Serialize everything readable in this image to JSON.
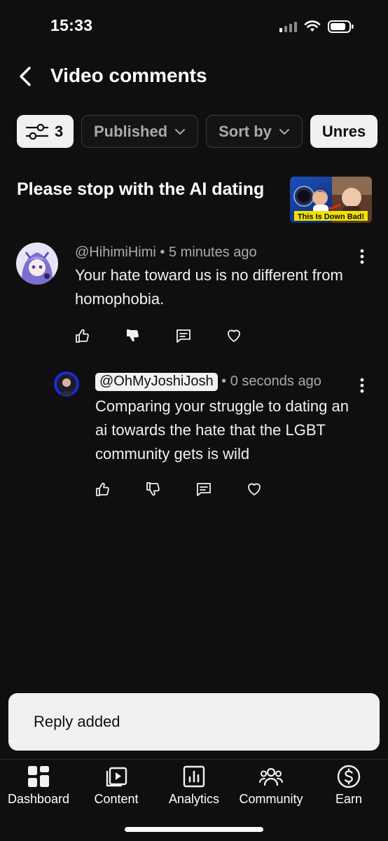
{
  "status_bar": {
    "time": "15:33"
  },
  "header": {
    "title": "Video comments"
  },
  "filters": {
    "filter_count": "3",
    "published": "Published",
    "sort_by": "Sort by",
    "unresponded": "Unres"
  },
  "video": {
    "title": "Please stop with the AI dating",
    "thumbnail_caption": "This Is Down Bad!"
  },
  "comments": [
    {
      "author": "@HihimiHimi",
      "time": "5 minutes ago",
      "text": "Your hate toward us is no different from homophobia."
    }
  ],
  "reply": {
    "author": "@OhMyJoshiJosh",
    "time": "0 seconds ago",
    "text": "Comparing your struggle to dating an ai towards the hate that the LGBT community gets is wild"
  },
  "separator": "•",
  "toast": {
    "message": "Reply added"
  },
  "bottom_nav": {
    "items": [
      {
        "label": "Dashboard",
        "icon": "dashboard-icon"
      },
      {
        "label": "Content",
        "icon": "content-icon"
      },
      {
        "label": "Analytics",
        "icon": "analytics-icon"
      },
      {
        "label": "Community",
        "icon": "community-icon"
      },
      {
        "label": "Earn",
        "icon": "earn-icon"
      }
    ]
  },
  "colors": {
    "background": "#0f0f0f",
    "surface_light": "#f1f1f1",
    "secondary_text": "#aaaaaa",
    "thumbnail_caption_bg": "#f2e205"
  }
}
